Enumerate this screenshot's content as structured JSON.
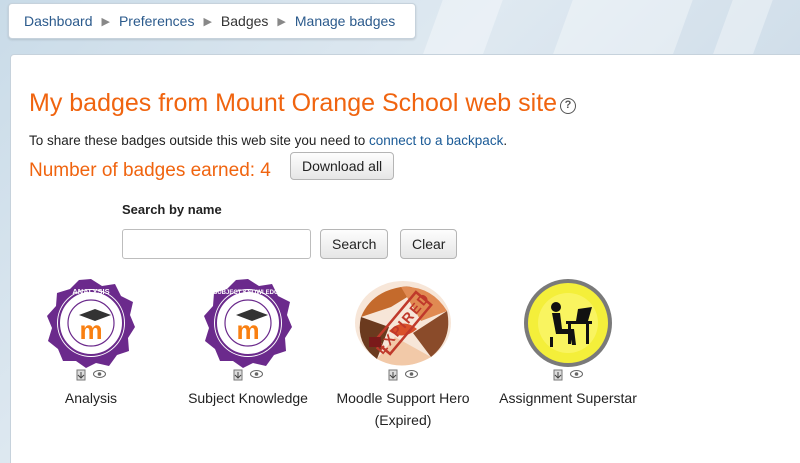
{
  "breadcrumb": {
    "items": [
      "Dashboard",
      "Preferences",
      "Badges",
      "Manage badges"
    ]
  },
  "page": {
    "title": "My badges from Mount Orange School web site",
    "share_text": "To share these badges outside this web site you need to ",
    "share_link": "connect to a backpack",
    "share_end": ".",
    "count_text": "Number of badges earned: 4",
    "download_label": "Download all"
  },
  "search": {
    "label": "Search by name",
    "value": "",
    "search_label": "Search",
    "clear_label": "Clear"
  },
  "badges": [
    {
      "name": "Analysis",
      "ribbon": "ANALYSIS",
      "expired": ""
    },
    {
      "name": "Subject Knowledge",
      "ribbon": "SUBJECT KNOWLEDGE",
      "expired": ""
    },
    {
      "name": "Moodle Support Hero",
      "ribbon": "EXPIRED",
      "expired": "(Expired)"
    },
    {
      "name": "Assignment Superstar",
      "ribbon": "",
      "expired": ""
    }
  ],
  "colors": {
    "accent_orange": "#f0640f",
    "link_blue": "#1a5a96",
    "badge_purple": "#6b2a8c",
    "expired_stamp": "#c0392b",
    "superstar_yellow": "#f4ef3a"
  },
  "icons": {
    "action_1": "download-icon",
    "action_2": "eye-icon",
    "help": "help-icon"
  }
}
